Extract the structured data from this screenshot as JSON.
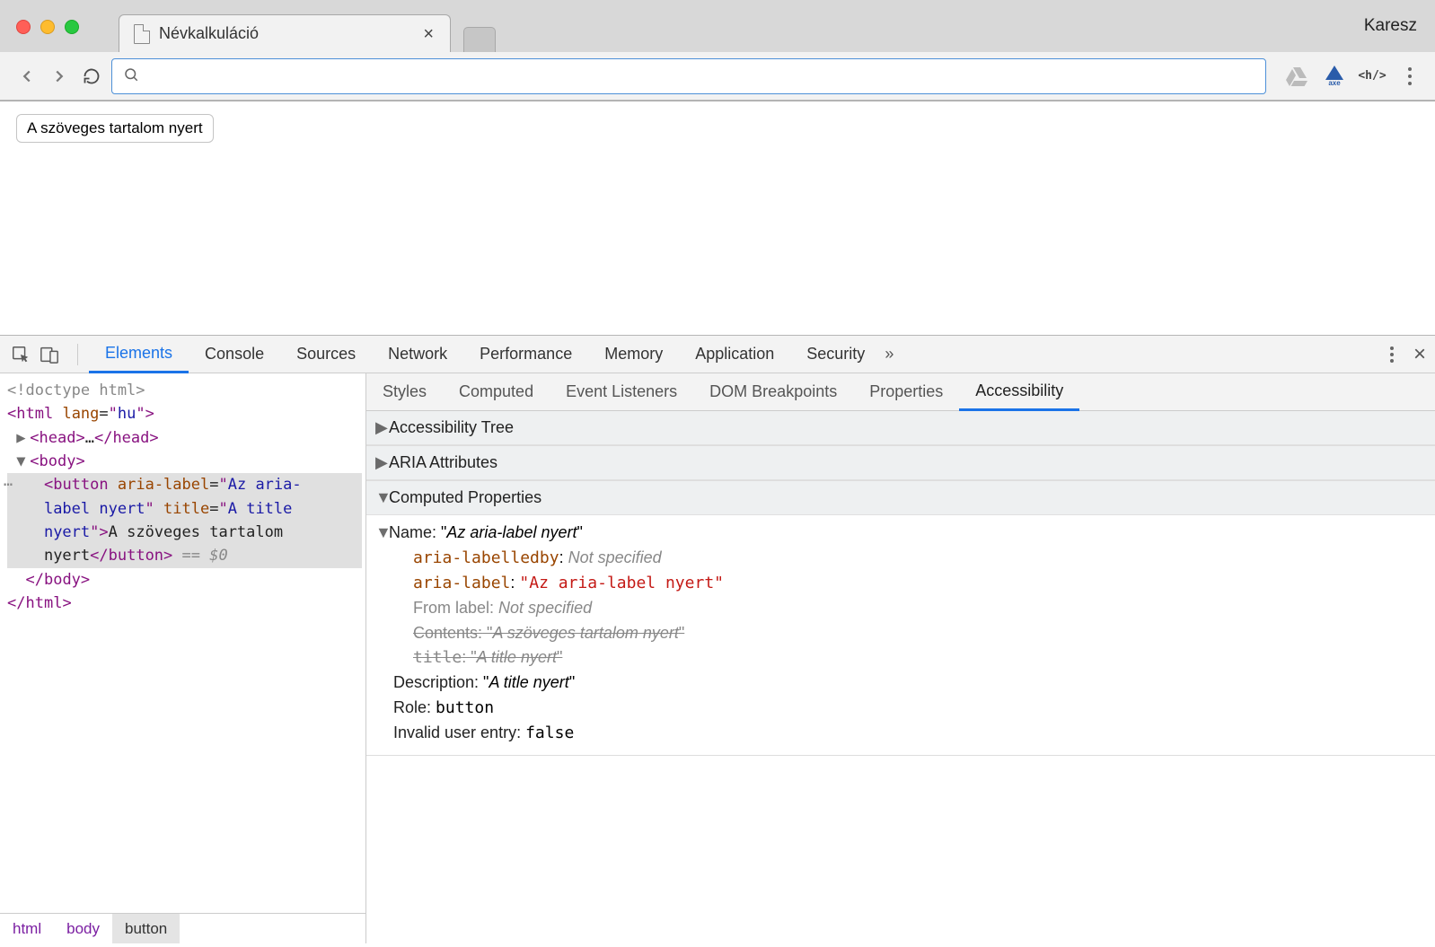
{
  "browser": {
    "tab_title": "Névkalkuláció",
    "profile": "Karesz",
    "address_value": ""
  },
  "page": {
    "button_label": "A szöveges tartalom nyert"
  },
  "devtools": {
    "main_tabs": [
      "Elements",
      "Console",
      "Sources",
      "Network",
      "Performance",
      "Memory",
      "Application",
      "Security"
    ],
    "active_main_tab": 0,
    "sub_tabs": [
      "Styles",
      "Computed",
      "Event Listeners",
      "DOM Breakpoints",
      "Properties",
      "Accessibility"
    ],
    "active_sub_tab": 5,
    "breadcrumb": [
      "html",
      "body",
      "button"
    ],
    "dom": {
      "doctype": "<!doctype html>",
      "html_open": "html",
      "html_lang_attr": "lang",
      "html_lang_val": "hu",
      "head": "head",
      "head_ellipsis": "…",
      "body": "body",
      "button": "button",
      "aria_label_attr": "aria-label",
      "aria_label_val": "Az aria-label nyert",
      "title_attr": "title",
      "title_val": "A title nyert",
      "button_text": "A szöveges tartalom nyert",
      "selected_ref": "== $0"
    },
    "acc": {
      "tree_title": "Accessibility Tree",
      "aria_title": "ARIA Attributes",
      "computed_title": "Computed Properties",
      "name_label": "Name:",
      "name_value": "Az aria-label nyert",
      "aria_labelledby_label": "aria-labelledby",
      "not_specified": "Not specified",
      "aria_label_label": "aria-label",
      "aria_label_value": "Az aria-label nyert",
      "from_label_label": "From label:",
      "contents_label": "Contents:",
      "contents_value": "A szöveges tartalom nyert",
      "title_label": "title",
      "title_value": "A title nyert",
      "description_label": "Description:",
      "description_value": "A title nyert",
      "role_label": "Role:",
      "role_value": "button",
      "invalid_label": "Invalid user entry:",
      "invalid_value": "false"
    }
  }
}
